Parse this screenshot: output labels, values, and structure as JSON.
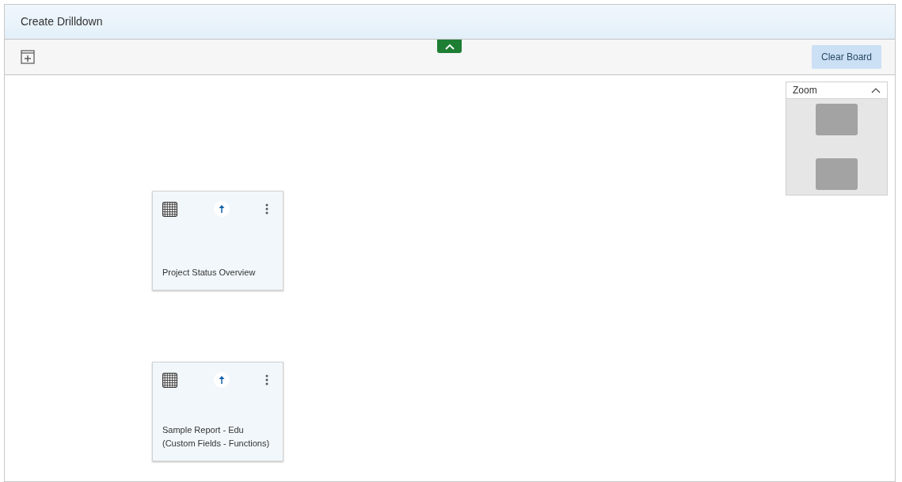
{
  "window": {
    "title": "Create Drilldown"
  },
  "toolbar": {
    "clear_button": "Clear Board"
  },
  "zoom_panel": {
    "title": "Zoom",
    "expanded": true
  },
  "nodes": [
    {
      "title": "Project Status Overview"
    },
    {
      "title": "Sample Report - Edu (Custom Fields - Functions)"
    }
  ]
}
